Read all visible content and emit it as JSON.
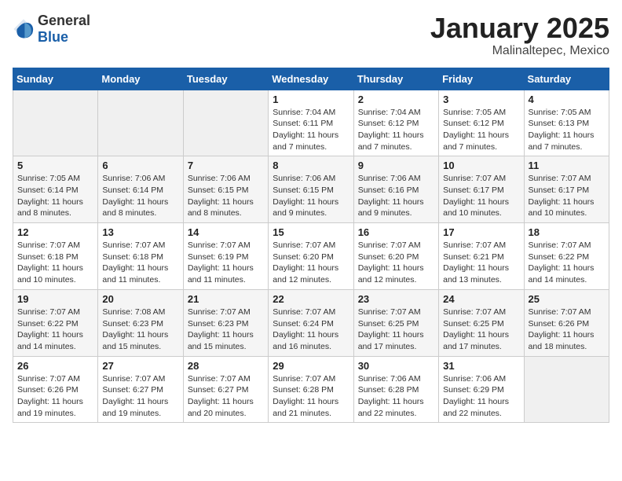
{
  "logo": {
    "general": "General",
    "blue": "Blue"
  },
  "title": {
    "month_year": "January 2025",
    "location": "Malinaltepec, Mexico"
  },
  "weekdays": [
    "Sunday",
    "Monday",
    "Tuesday",
    "Wednesday",
    "Thursday",
    "Friday",
    "Saturday"
  ],
  "weeks": [
    [
      {
        "day": "",
        "info": ""
      },
      {
        "day": "",
        "info": ""
      },
      {
        "day": "",
        "info": ""
      },
      {
        "day": "1",
        "info": "Sunrise: 7:04 AM\nSunset: 6:11 PM\nDaylight: 11 hours\nand 7 minutes."
      },
      {
        "day": "2",
        "info": "Sunrise: 7:04 AM\nSunset: 6:12 PM\nDaylight: 11 hours\nand 7 minutes."
      },
      {
        "day": "3",
        "info": "Sunrise: 7:05 AM\nSunset: 6:12 PM\nDaylight: 11 hours\nand 7 minutes."
      },
      {
        "day": "4",
        "info": "Sunrise: 7:05 AM\nSunset: 6:13 PM\nDaylight: 11 hours\nand 7 minutes."
      }
    ],
    [
      {
        "day": "5",
        "info": "Sunrise: 7:05 AM\nSunset: 6:14 PM\nDaylight: 11 hours\nand 8 minutes."
      },
      {
        "day": "6",
        "info": "Sunrise: 7:06 AM\nSunset: 6:14 PM\nDaylight: 11 hours\nand 8 minutes."
      },
      {
        "day": "7",
        "info": "Sunrise: 7:06 AM\nSunset: 6:15 PM\nDaylight: 11 hours\nand 8 minutes."
      },
      {
        "day": "8",
        "info": "Sunrise: 7:06 AM\nSunset: 6:15 PM\nDaylight: 11 hours\nand 9 minutes."
      },
      {
        "day": "9",
        "info": "Sunrise: 7:06 AM\nSunset: 6:16 PM\nDaylight: 11 hours\nand 9 minutes."
      },
      {
        "day": "10",
        "info": "Sunrise: 7:07 AM\nSunset: 6:17 PM\nDaylight: 11 hours\nand 10 minutes."
      },
      {
        "day": "11",
        "info": "Sunrise: 7:07 AM\nSunset: 6:17 PM\nDaylight: 11 hours\nand 10 minutes."
      }
    ],
    [
      {
        "day": "12",
        "info": "Sunrise: 7:07 AM\nSunset: 6:18 PM\nDaylight: 11 hours\nand 10 minutes."
      },
      {
        "day": "13",
        "info": "Sunrise: 7:07 AM\nSunset: 6:18 PM\nDaylight: 11 hours\nand 11 minutes."
      },
      {
        "day": "14",
        "info": "Sunrise: 7:07 AM\nSunset: 6:19 PM\nDaylight: 11 hours\nand 11 minutes."
      },
      {
        "day": "15",
        "info": "Sunrise: 7:07 AM\nSunset: 6:20 PM\nDaylight: 11 hours\nand 12 minutes."
      },
      {
        "day": "16",
        "info": "Sunrise: 7:07 AM\nSunset: 6:20 PM\nDaylight: 11 hours\nand 12 minutes."
      },
      {
        "day": "17",
        "info": "Sunrise: 7:07 AM\nSunset: 6:21 PM\nDaylight: 11 hours\nand 13 minutes."
      },
      {
        "day": "18",
        "info": "Sunrise: 7:07 AM\nSunset: 6:22 PM\nDaylight: 11 hours\nand 14 minutes."
      }
    ],
    [
      {
        "day": "19",
        "info": "Sunrise: 7:07 AM\nSunset: 6:22 PM\nDaylight: 11 hours\nand 14 minutes."
      },
      {
        "day": "20",
        "info": "Sunrise: 7:08 AM\nSunset: 6:23 PM\nDaylight: 11 hours\nand 15 minutes."
      },
      {
        "day": "21",
        "info": "Sunrise: 7:07 AM\nSunset: 6:23 PM\nDaylight: 11 hours\nand 15 minutes."
      },
      {
        "day": "22",
        "info": "Sunrise: 7:07 AM\nSunset: 6:24 PM\nDaylight: 11 hours\nand 16 minutes."
      },
      {
        "day": "23",
        "info": "Sunrise: 7:07 AM\nSunset: 6:25 PM\nDaylight: 11 hours\nand 17 minutes."
      },
      {
        "day": "24",
        "info": "Sunrise: 7:07 AM\nSunset: 6:25 PM\nDaylight: 11 hours\nand 17 minutes."
      },
      {
        "day": "25",
        "info": "Sunrise: 7:07 AM\nSunset: 6:26 PM\nDaylight: 11 hours\nand 18 minutes."
      }
    ],
    [
      {
        "day": "26",
        "info": "Sunrise: 7:07 AM\nSunset: 6:26 PM\nDaylight: 11 hours\nand 19 minutes."
      },
      {
        "day": "27",
        "info": "Sunrise: 7:07 AM\nSunset: 6:27 PM\nDaylight: 11 hours\nand 19 minutes."
      },
      {
        "day": "28",
        "info": "Sunrise: 7:07 AM\nSunset: 6:27 PM\nDaylight: 11 hours\nand 20 minutes."
      },
      {
        "day": "29",
        "info": "Sunrise: 7:07 AM\nSunset: 6:28 PM\nDaylight: 11 hours\nand 21 minutes."
      },
      {
        "day": "30",
        "info": "Sunrise: 7:06 AM\nSunset: 6:28 PM\nDaylight: 11 hours\nand 22 minutes."
      },
      {
        "day": "31",
        "info": "Sunrise: 7:06 AM\nSunset: 6:29 PM\nDaylight: 11 hours\nand 22 minutes."
      },
      {
        "day": "",
        "info": ""
      }
    ]
  ]
}
